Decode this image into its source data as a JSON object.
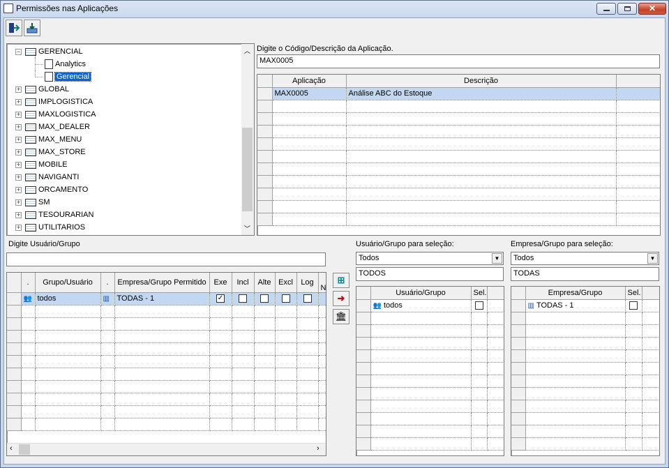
{
  "window": {
    "title": "Permissões nas Aplicações"
  },
  "toolbar": {
    "exit_icon": "exit-door-icon",
    "save_icon": "save-tray-icon"
  },
  "tree": {
    "items": [
      {
        "label": "GERENCIAL",
        "expanded": true
      },
      {
        "label": "Analytics",
        "child": true
      },
      {
        "label": "Gerencial",
        "child": true,
        "selected": true
      },
      {
        "label": "GLOBAL"
      },
      {
        "label": "IMPLOGISTICA"
      },
      {
        "label": "MAXLOGISTICA"
      },
      {
        "label": "MAX_DEALER"
      },
      {
        "label": "MAX_MENU"
      },
      {
        "label": "MAX_STORE"
      },
      {
        "label": "MOBILE"
      },
      {
        "label": "NAVIGANTI"
      },
      {
        "label": "ORCAMENTO"
      },
      {
        "label": "SM"
      },
      {
        "label": "TESOURARIAN"
      },
      {
        "label": "UTILITARIOS"
      }
    ]
  },
  "app_search": {
    "label": "Digite o Código/Descrição da Aplicação.",
    "value": "MAX0005"
  },
  "app_grid": {
    "headers": [
      "Aplicação",
      "Descrição"
    ],
    "rows": [
      {
        "code": "MAX0005",
        "desc": "Análise ABC do Estoque"
      }
    ]
  },
  "user_search": {
    "label": "Digite Usuário/Grupo",
    "value": ""
  },
  "perm_grid": {
    "headers": {
      "dot1": ".",
      "user": "Grupo/Usuário",
      "dot2": ".",
      "company": "Empresa/Grupo Permitido",
      "exe": "Exe",
      "incl": "Incl",
      "alte": "Alte",
      "excl": "Excl",
      "log": "Log",
      "more": "N"
    },
    "rows": [
      {
        "user": "todos",
        "company": "TODAS - 1",
        "exe": true,
        "incl": false,
        "alte": false,
        "excl": false,
        "log": false
      }
    ]
  },
  "user_select": {
    "label": "Usuário/Grupo para seleção:",
    "combo": "Todos",
    "filter": "TODOS",
    "headers": {
      "user": "Usuário/Grupo",
      "sel": "Sel."
    },
    "rows": [
      {
        "user": "todos",
        "sel": false
      }
    ]
  },
  "company_select": {
    "label": "Empresa/Grupo para seleção:",
    "combo": "Todos",
    "filter": "TODAS",
    "headers": {
      "company": "Empresa/Grupo",
      "sel": "Sel."
    },
    "rows": [
      {
        "company": "TODAS - 1",
        "sel": false
      }
    ]
  }
}
